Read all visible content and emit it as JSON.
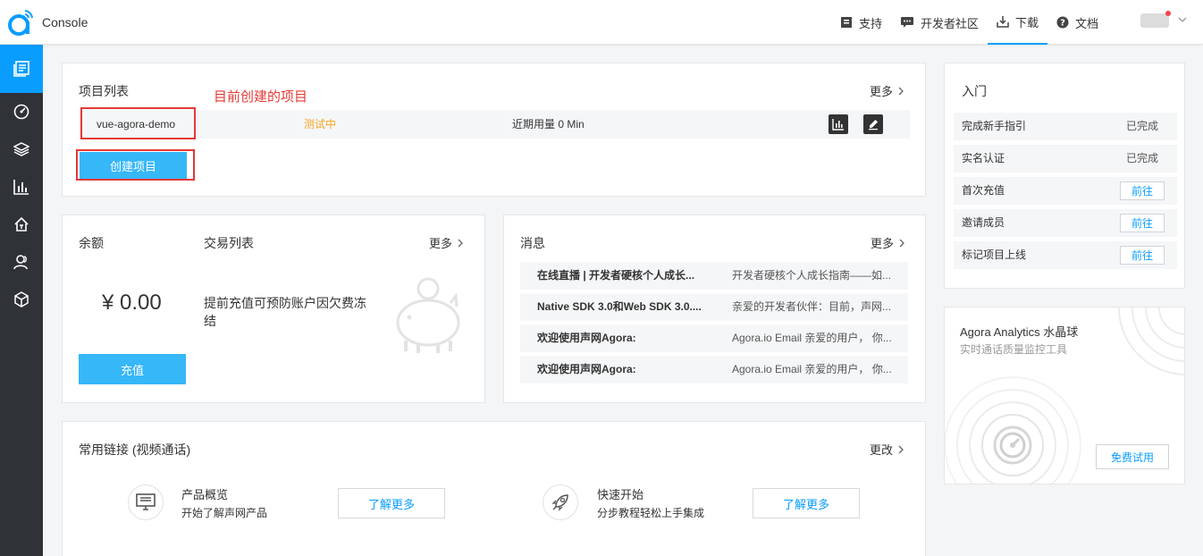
{
  "header": {
    "title": "Console",
    "nav": [
      {
        "label": "支持",
        "icon": "book-icon"
      },
      {
        "label": "开发者社区",
        "icon": "community-icon"
      },
      {
        "label": "下载",
        "icon": "download-icon"
      },
      {
        "label": "文档",
        "icon": "help-icon"
      }
    ],
    "active_nav": "下载"
  },
  "sidebar": {
    "items": [
      {
        "icon": "projects-icon",
        "active": true
      },
      {
        "icon": "gauge-icon"
      },
      {
        "icon": "layers-icon"
      },
      {
        "icon": "bar-chart-icon"
      },
      {
        "icon": "home-icon"
      },
      {
        "icon": "users-icon"
      },
      {
        "icon": "cube-icon"
      }
    ]
  },
  "projects": {
    "title": "项目列表",
    "more": "更多",
    "annotation": "目前创建的项目",
    "rows": [
      {
        "name": "vue-agora-demo",
        "status": "测试中",
        "usage": "近期用量 0 Min"
      }
    ],
    "create_label": "创建项目"
  },
  "balance": {
    "title": "余额",
    "amount": "¥ 0.00",
    "transactions_title": "交易列表",
    "more": "更多",
    "hint": "提前充值可预防账户因欠费冻结",
    "recharge_label": "充值"
  },
  "messages": {
    "title": "消息",
    "more": "更多",
    "items": [
      {
        "title": "在线直播 | 开发者硬核个人成长...",
        "body": "开发者硬核个人成长指南——如..."
      },
      {
        "title": "Native SDK 3.0和Web SDK 3.0....",
        "body": "亲爱的开发者伙伴：目前，声网..."
      },
      {
        "title": "欢迎使用声网Agora:",
        "body": "Agora.io Email 亲爱的用户， 你..."
      },
      {
        "title": "欢迎使用声网Agora:",
        "body": "Agora.io Email 亲爱的用户， 你..."
      }
    ]
  },
  "links": {
    "title": "常用链接 (视频通话)",
    "edit": "更改",
    "items": [
      {
        "title": "产品概览",
        "subtitle": "开始了解声网产品",
        "button": "了解更多",
        "icon": "monitor-icon"
      },
      {
        "title": "快速开始",
        "subtitle": "分步教程轻松上手集成",
        "button": "了解更多",
        "icon": "rocket-icon"
      }
    ]
  },
  "getting_started": {
    "title": "入门",
    "items": [
      {
        "label": "完成新手指引",
        "status": "已完成"
      },
      {
        "label": "实名认证",
        "status": "已完成"
      },
      {
        "label": "首次充值",
        "action": "前往"
      },
      {
        "label": "邀请成员",
        "action": "前往"
      },
      {
        "label": "标记项目上线",
        "action": "前往"
      }
    ]
  },
  "analytics": {
    "title": "Agora Analytics 水晶球",
    "subtitle": "实时通话质量监控工具",
    "trial_label": "免费试用"
  },
  "colors": {
    "accent": "#099dfd",
    "primary_button": "#36b7f8",
    "sidebar": "#2f3237",
    "warning": "#f5a623",
    "annotation": "#e53935"
  }
}
